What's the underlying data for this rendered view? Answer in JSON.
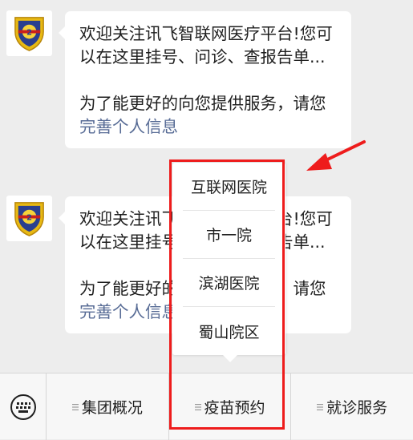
{
  "messages": [
    {
      "avatar_icon": "hospital-emblem-icon",
      "line1": "欢迎关注讯飞智联网医疗平台!您可以在这里挂号、问诊、查报告单...",
      "line2_prefix": "为了能更好的向您提供服务，请您",
      "line2_link": "完善个人信息"
    },
    {
      "avatar_icon": "hospital-emblem-icon",
      "line1": "欢迎关注讯飞智联网医疗平台!您可以在这里挂号、问诊、查报告单...",
      "line2_prefix": "为了能更好的向您提供服务，请您",
      "line2_link": "完善个人信息"
    }
  ],
  "menu": {
    "keyboard_icon": "keyboard-icon",
    "items": [
      "集团概况",
      "疫苗预约",
      "就诊服务"
    ]
  },
  "popup": {
    "items": [
      "互联网医院",
      "市一院",
      "滨湖医院",
      "蜀山院区"
    ]
  },
  "colors": {
    "link": "#576b95",
    "annotation": "#ee1c1c",
    "background": "#ededed"
  }
}
